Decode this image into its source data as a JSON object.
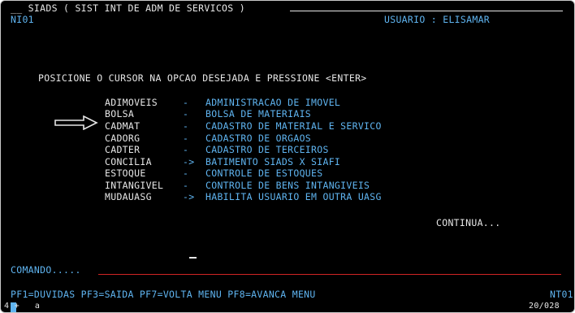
{
  "header": {
    "title": "__ SIADS ( SIST INT DE ADM DE SERVICOS )",
    "screen_id": "NI01",
    "user_label": "USUARIO : ELISAMAR"
  },
  "instruction": "POSICIONE O CURSOR NA OPCAO DESEJADA E PRESSIONE <ENTER>",
  "menu": [
    {
      "code": "ADIMOVEIS",
      "sep": "-",
      "desc": "ADMINISTRACAO DE IMOVEL"
    },
    {
      "code": "BOLSA",
      "sep": "-",
      "desc": "BOLSA DE MATERIAIS"
    },
    {
      "code": "CADMAT",
      "sep": "-",
      "desc": "CADASTRO DE MATERIAL E SERVICO"
    },
    {
      "code": "CADORG",
      "sep": "-",
      "desc": "CADASTRO DE ORGAOS"
    },
    {
      "code": "CADTER",
      "sep": "-",
      "desc": "CADASTRO DE TERCEIROS"
    },
    {
      "code": "CONCILIA",
      "sep": "->",
      "desc": "BATIMENTO SIADS X SIAFI"
    },
    {
      "code": "ESTOQUE",
      "sep": "-",
      "desc": "CONTROLE DE ESTOQUES"
    },
    {
      "code": "INTANGIVEL",
      "sep": "-",
      "desc": "CONTROLE DE BENS INTANGIVEIS"
    },
    {
      "code": "MUDAUASG",
      "sep": "->",
      "desc": "HABILITA USUARIO EM OUTRA UASG"
    }
  ],
  "continua": "CONTINUA...",
  "command_label": "COMANDO.....",
  "function_keys": "PF1=DUVIDAS PF3=SAIDA PF7=VOLTA MENU PF8=AVANCA MENU",
  "footer_right": "NT01",
  "status_left": "4 +   a",
  "status_right": "20/028",
  "colors": {
    "background": "#000000",
    "text": "#e6e6e6",
    "accent": "#5fb4f0",
    "divider": "#d02424"
  },
  "icons": {
    "selection_arrow": "right-arrow-outline-icon",
    "cursor": "cursor-block-icon"
  }
}
